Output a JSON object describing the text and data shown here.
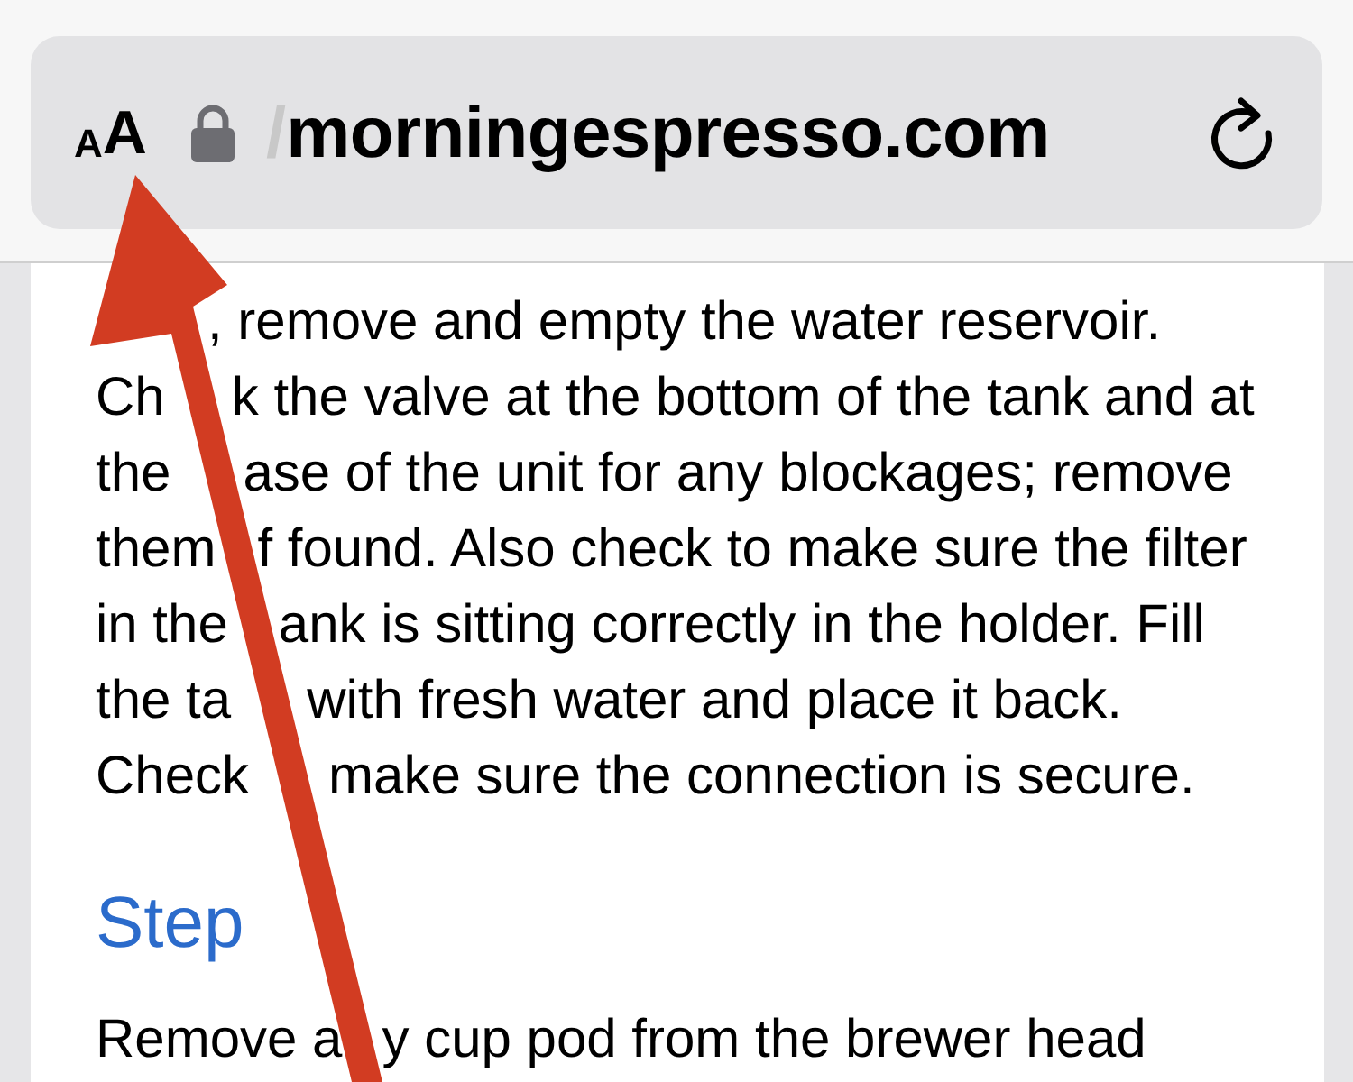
{
  "address_bar": {
    "text_size_button": {
      "small": "A",
      "large": "A"
    },
    "secure": true,
    "url_prefix": "/",
    "url": "morningespresso.com"
  },
  "article": {
    "paragraph_lines": [
      {
        "right": ", remove and empty the water reservoir."
      },
      {
        "left": "Ch",
        "right": "k the valve at the bottom of the tank and at"
      },
      {
        "left": "the",
        "right": "ase of the unit for any blockages; remove"
      },
      {
        "left": "them",
        "right": "f found. Also check to make sure the filter"
      },
      {
        "left": "in the",
        "right": "ank is sitting correctly in the holder. Fill"
      },
      {
        "left": "the ta",
        "right": "with fresh water and place it back."
      },
      {
        "left": "Check",
        "right": "make sure the connection is secure."
      }
    ],
    "heading": "Step",
    "next_line": {
      "left": "Remove a",
      "right": "y cup pod from the brewer head"
    }
  }
}
